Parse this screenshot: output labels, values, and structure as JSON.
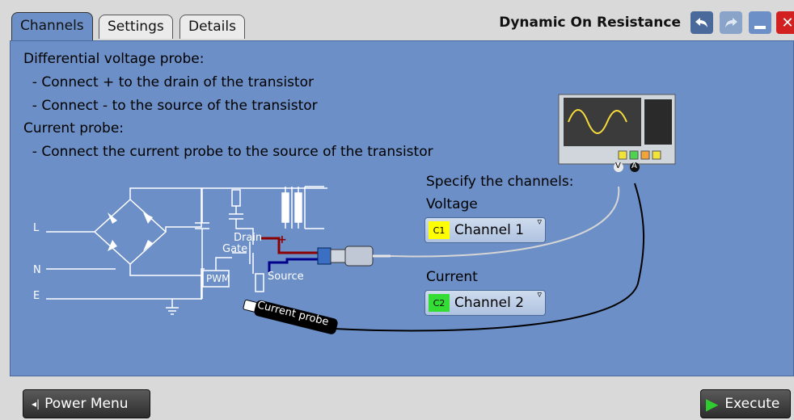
{
  "tabs": [
    {
      "label": "Channels"
    },
    {
      "label": "Settings"
    },
    {
      "label": "Details"
    }
  ],
  "title": "Dynamic On Resistance",
  "instructions": [
    "Differential voltage probe:",
    "  - Connect + to the drain of the transistor",
    "  - Connect - to the source of the transistor",
    "Current probe:",
    "  - Connect the current probe to the source of the transistor"
  ],
  "diagram": {
    "L": "L",
    "N": "N",
    "E": "E",
    "drain": "Drain",
    "gate": "Gate",
    "pwm": "PWM",
    "source": "Source",
    "plus": "+",
    "minus": "-",
    "current_probe": "Current probe",
    "scope_v": "V",
    "scope_a": "A"
  },
  "channels": {
    "heading": "Specify the channels:",
    "voltage_label": "Voltage",
    "voltage_chip": "C1",
    "voltage_value": "Channel 1",
    "voltage_color": "#ffff00",
    "current_label": "Current",
    "current_chip": "C2",
    "current_value": "Channel 2",
    "current_color": "#33dd33"
  },
  "buttons": {
    "power_menu": "Power Menu",
    "execute": "Execute"
  },
  "icons": [
    "undo-icon",
    "redo-icon",
    "minimize-icon",
    "close-icon"
  ]
}
